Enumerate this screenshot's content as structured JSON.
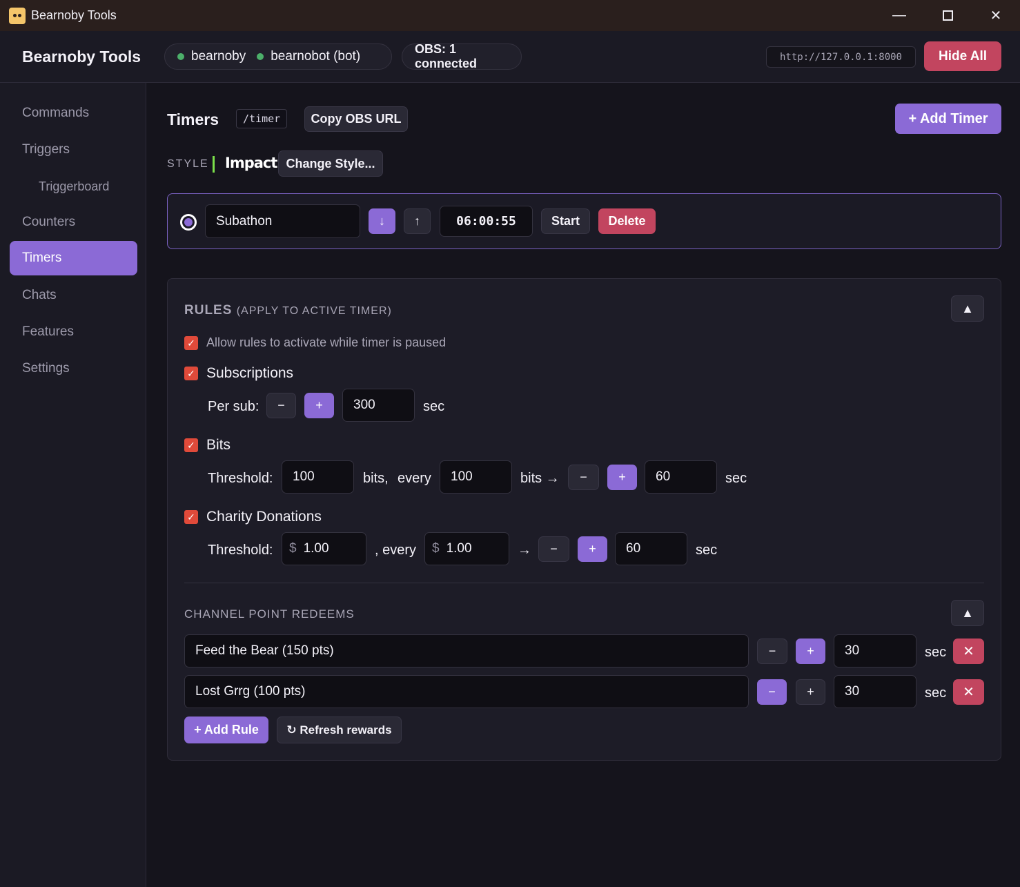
{
  "window": {
    "title": "Bearnoby Tools"
  },
  "header": {
    "brand": "Bearnoby Tools",
    "accounts": [
      {
        "name": "bearnoby",
        "status_color": "#4caf6a"
      },
      {
        "name": "bearnobot (bot)",
        "status_color": "#4caf6a"
      }
    ],
    "obs_status": "OBS: 1 connected",
    "server_url": "http://127.0.0.1:8000",
    "hide_all_label": "Hide All"
  },
  "sidebar": {
    "items": [
      {
        "label": "Commands"
      },
      {
        "label": "Triggers"
      },
      {
        "label": "Triggerboard"
      },
      {
        "label": "Counters"
      },
      {
        "label": "Timers"
      },
      {
        "label": "Chats"
      },
      {
        "label": "Features"
      },
      {
        "label": "Settings"
      }
    ],
    "active": "Timers"
  },
  "main": {
    "title": "Timers",
    "route": "/timer",
    "copy_obs_label": "Copy OBS URL",
    "add_timer_label": "+ Add Timer",
    "style_label": "STYLE",
    "style_name": "Impact",
    "change_style_label": "Change Style...",
    "timer": {
      "name": "Subathon",
      "down_label": "↓",
      "up_label": "↑",
      "time": "06:00:55",
      "start_label": "Start",
      "delete_label": "Delete",
      "active": true
    },
    "rules": {
      "title": "RULES",
      "subtitle": "(APPLY TO ACTIVE TIMER)",
      "collapse_icon": "▲",
      "allow_paused_label": "Allow rules to activate while timer is paused",
      "allow_paused": true,
      "subscriptions": {
        "label": "Subscriptions",
        "checked": true,
        "per_label": "Per sub:",
        "value": "300",
        "unit": "sec"
      },
      "bits": {
        "label": "Bits",
        "checked": true,
        "threshold_label": "Threshold:",
        "threshold": "100",
        "bits_label": "bits,",
        "every_label": "every",
        "every": "100",
        "arrow_label": "bits →",
        "value": "60",
        "unit": "sec"
      },
      "charity": {
        "label": "Charity Donations",
        "checked": true,
        "threshold_label": "Threshold:",
        "currency": "$",
        "threshold": "1.00",
        "every_label": ", every",
        "every": "1.00",
        "arrow": "→",
        "value": "60",
        "unit": "sec"
      },
      "minus": "−",
      "plus": "+"
    },
    "channel_points": {
      "title": "CHANNEL POINT REDEEMS",
      "collapse_icon": "▲",
      "redeems": [
        {
          "name": "Feed the Bear (150 pts)",
          "value": "30",
          "unit": "sec",
          "mode": "add"
        },
        {
          "name": "Lost Grrg (100 pts)",
          "value": "30",
          "unit": "sec",
          "mode": "subtract"
        }
      ],
      "add_rule_label": "+ Add Rule",
      "refresh_label": "↻ Refresh rewards"
    }
  },
  "colors": {
    "accent": "#8b6ad6",
    "danger": "#c2455f",
    "online": "#4caf6a",
    "checkbox": "#e04a3a",
    "style_bar": "#7be04a"
  }
}
